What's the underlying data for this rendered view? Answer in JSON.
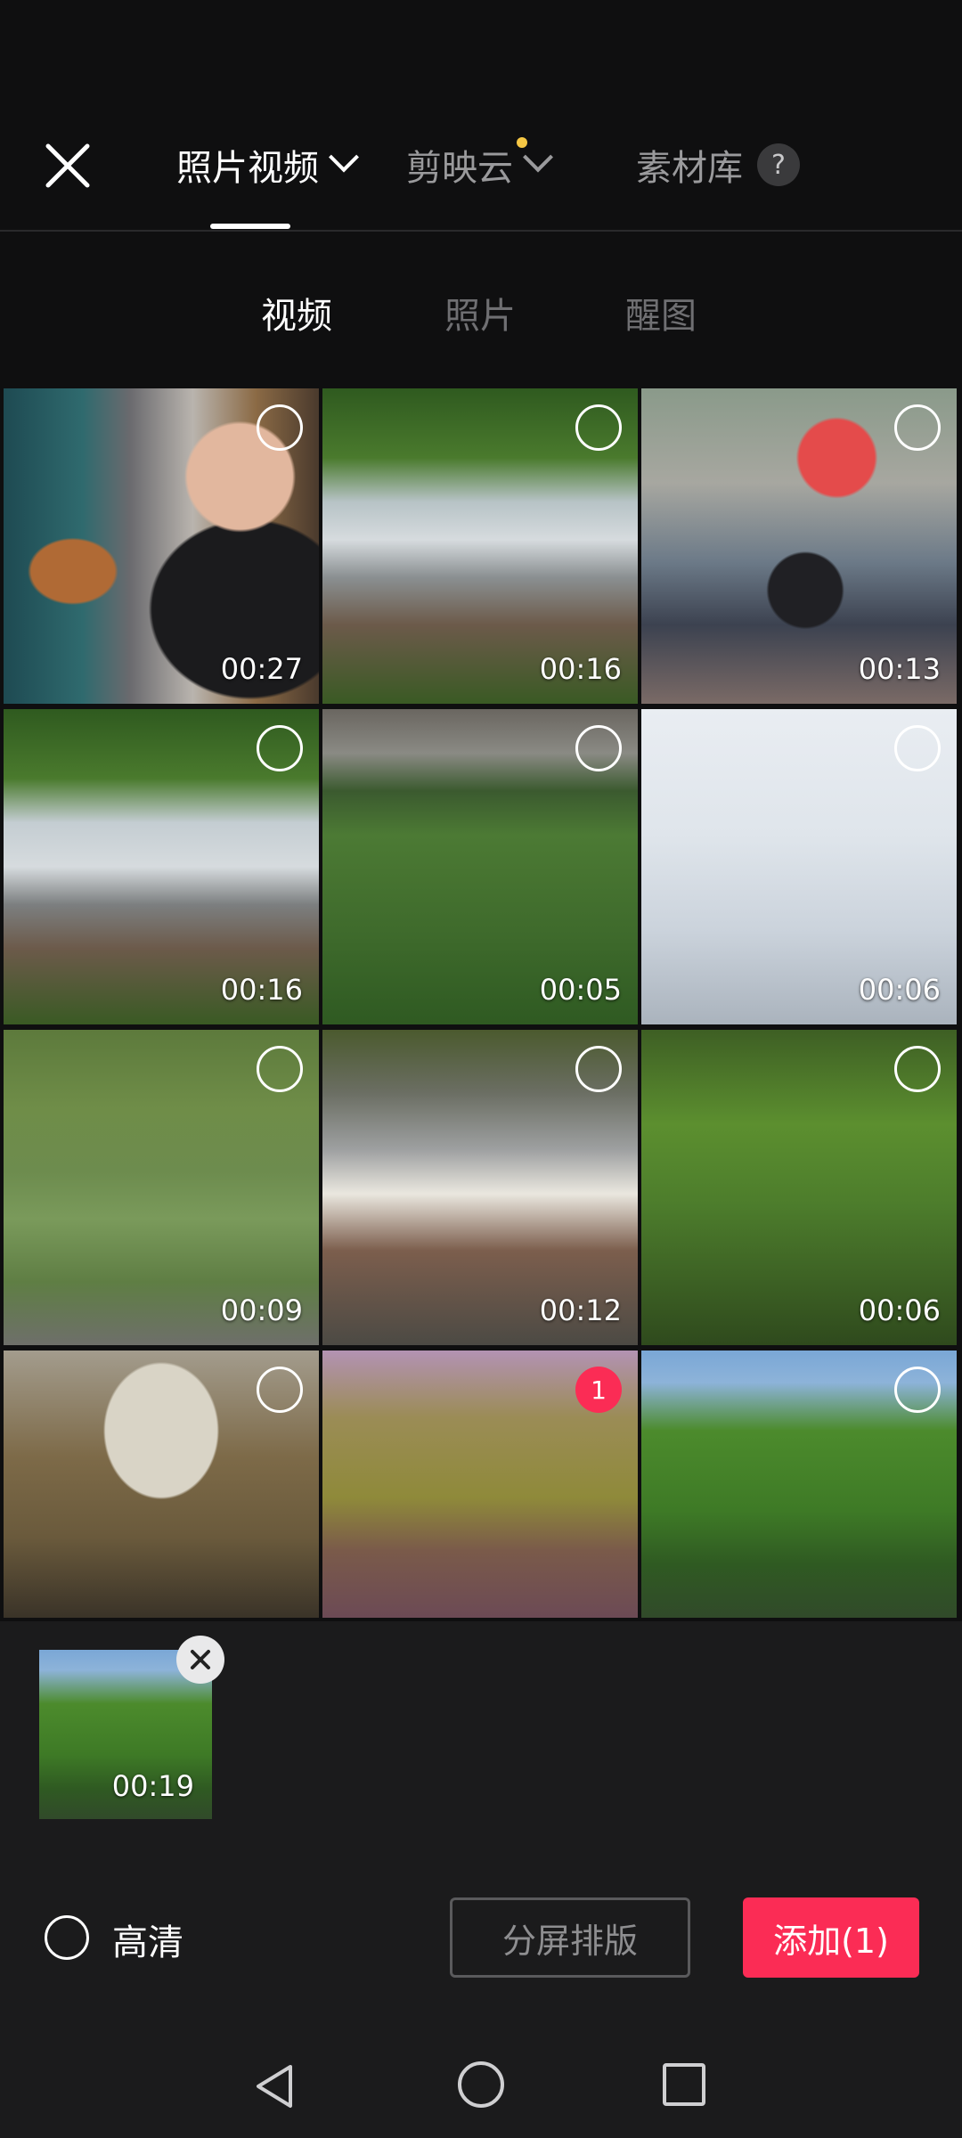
{
  "header": {
    "tabs": [
      {
        "label": "照片视频",
        "active": true
      },
      {
        "label": "剪映云",
        "active": false,
        "has_dot": true
      },
      {
        "label": "素材库",
        "active": false,
        "help": "?"
      }
    ]
  },
  "subtabs": {
    "items": [
      {
        "label": "视频",
        "active": true
      },
      {
        "label": "照片",
        "active": false
      },
      {
        "label": "醒图",
        "active": false
      }
    ]
  },
  "grid": {
    "tiles": [
      {
        "duration": "00:27",
        "selected": false
      },
      {
        "duration": "00:16",
        "selected": false
      },
      {
        "duration": "00:13",
        "selected": false
      },
      {
        "duration": "00:16",
        "selected": false
      },
      {
        "duration": "00:05",
        "selected": false
      },
      {
        "duration": "00:06",
        "selected": false
      },
      {
        "duration": "00:09",
        "selected": false
      },
      {
        "duration": "00:12",
        "selected": false
      },
      {
        "duration": "00:06",
        "selected": false
      },
      {
        "duration": "",
        "selected": false
      },
      {
        "duration": "",
        "selected": true,
        "selection_number": "1"
      },
      {
        "duration": "",
        "selected": false
      }
    ]
  },
  "selected_strip": {
    "items": [
      {
        "duration": "00:19"
      }
    ]
  },
  "bottom_bar": {
    "hd_label": "高清",
    "split_label": "分屏排版",
    "add_label": "添加(1)"
  },
  "colors": {
    "accent": "#fb2c55",
    "background": "#0f0f10",
    "panel": "#1b1b1c",
    "dot": "#f6c744"
  }
}
